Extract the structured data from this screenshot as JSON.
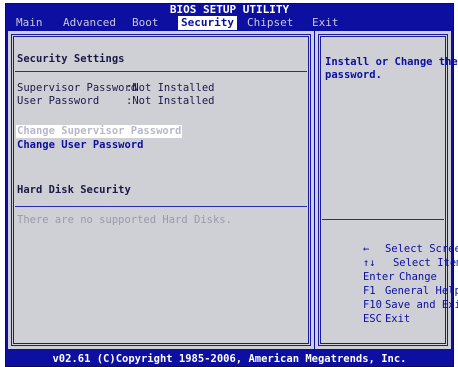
{
  "window": {
    "title": "BIOS SETUP UTILITY",
    "footer": "v02.61 (C)Copyright 1985-2006, American Megatrends, Inc."
  },
  "menu": [
    {
      "label": "Main"
    },
    {
      "label": "Advanced"
    },
    {
      "label": "Boot"
    },
    {
      "label": "Security"
    },
    {
      "label": "Chipset"
    },
    {
      "label": "Exit"
    }
  ],
  "left": {
    "heading": "Security Settings",
    "supervisor_label": "Supervisor Password",
    "supervisor_value": ":Not Installed",
    "user_label": "User Password",
    "user_value": ":Not Installed",
    "change_supervisor": "Change Supervisor Password",
    "change_user": "Change User Password",
    "hdd_heading": "Hard Disk Security",
    "hdd_message": "There are no supported Hard Disks."
  },
  "right": {
    "help_text_1": "Install or Change the",
    "help_text_2": "password.",
    "keys": [
      {
        "key": "←",
        "desc": "Select Screen"
      },
      {
        "key": "↑↓",
        "desc": "Select Item"
      },
      {
        "key": "Enter",
        "desc": "Change"
      },
      {
        "key": "F1",
        "desc": "General Help"
      },
      {
        "key": "F10",
        "desc": "Save and Exit"
      },
      {
        "key": "ESC",
        "desc": "Exit"
      }
    ]
  },
  "colors": {
    "background": "#0c0fa0",
    "panel": "#cfcfd6",
    "highlight": "#ffffff"
  }
}
